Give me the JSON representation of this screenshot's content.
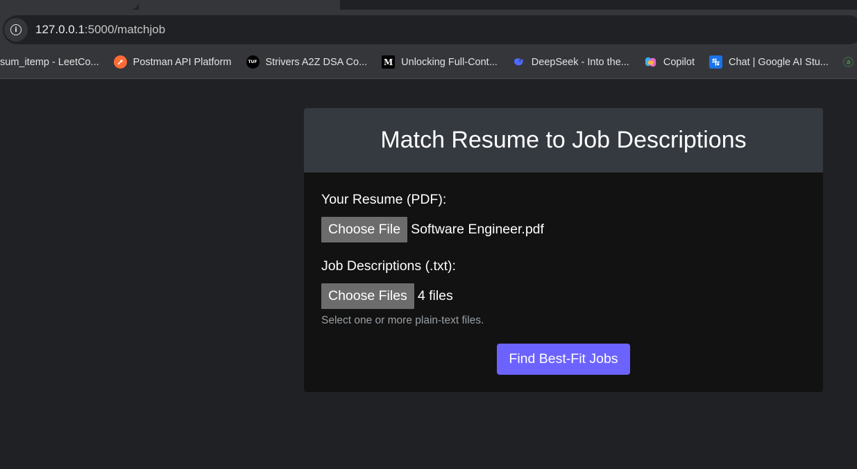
{
  "browser": {
    "url_host": "127.0.0.1",
    "url_path": ":5000/matchjob",
    "bookmarks": [
      {
        "label": "sum_itemp - LeetCo...",
        "icon": "leetcode-icon",
        "color": null
      },
      {
        "label": "Postman API Platform",
        "icon": "postman-icon",
        "color": "#ff6c37"
      },
      {
        "label": "Strivers A2Z DSA Co...",
        "icon": "tuf-icon",
        "color": "#000000"
      },
      {
        "label": "Unlocking Full-Cont...",
        "icon": "medium-icon",
        "color": "#000000"
      },
      {
        "label": "DeepSeek - Into the...",
        "icon": "deepseek-icon",
        "color": "#4d6bfe"
      },
      {
        "label": "Copilot",
        "icon": "copilot-icon",
        "color": "#8c6cff"
      },
      {
        "label": "Chat | Google AI Stu...",
        "icon": "google-ai-studio-icon",
        "color": "#1a73e8"
      }
    ]
  },
  "card": {
    "title": "Match Resume to Job Descriptions",
    "resume_label": "Your Resume (PDF):",
    "resume_button": "Choose File",
    "resume_status": "Software Engineer.pdf",
    "jobs_label": "Job Descriptions (.txt):",
    "jobs_button": "Choose Files",
    "jobs_status": "4 files",
    "jobs_hint": "Select one or more plain-text files.",
    "submit_label": "Find Best-Fit Jobs"
  },
  "colors": {
    "page_bg": "#202124",
    "card_header_bg": "#343a40",
    "card_body_bg": "#121212",
    "submit_bg": "#6c63ff",
    "file_button_bg": "#6c6c6c"
  }
}
